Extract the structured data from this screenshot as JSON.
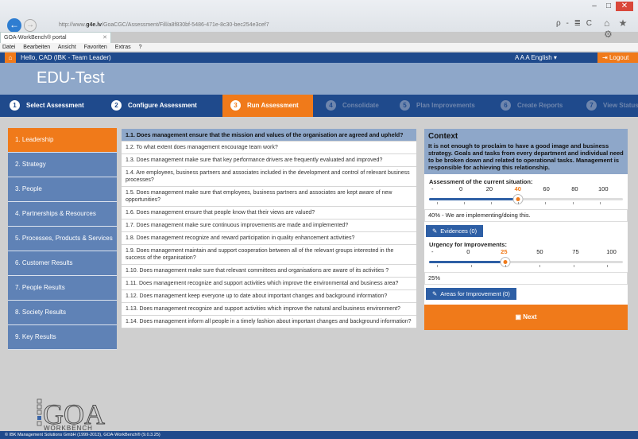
{
  "browser": {
    "url_prefix": "http://www.",
    "url_domain": "g4e.lv",
    "url_path": "/GoaCGC/Assessment/Fill/a8f830bf-5486-471e-8c30-bec254e3cef7",
    "tab_title": "GOA-WorkBench® portal",
    "menu": [
      "Datei",
      "Bearbeiten",
      "Ansicht",
      "Favoriten",
      "Extras",
      "?"
    ],
    "addr_tools": "ρ - ≣ C",
    "right_icons": "⌂ ★ ⚙"
  },
  "app": {
    "hello": "Hello, CAD (IBK - Team Leader)",
    "lang": "A A A   English ▾",
    "logout": "Logout",
    "title": "EDU-Test"
  },
  "steps": [
    {
      "num": "1",
      "label": "Select Assessment"
    },
    {
      "num": "2",
      "label": "Configure Assessment"
    },
    {
      "num": "3",
      "label": "Run Assessment"
    },
    {
      "num": "4",
      "label": "Consolidate"
    },
    {
      "num": "5",
      "label": "Plan Improvements"
    },
    {
      "num": "6",
      "label": "Create Reports"
    },
    {
      "num": "7",
      "label": "View Status"
    }
  ],
  "sidebar": [
    "1. Leadership",
    "2. Strategy",
    "3. People",
    "4. Partnerships & Resources",
    "5. Processes, Products & Services",
    "6. Customer Results",
    "7. People Results",
    "8. Society Results",
    "9. Key Results"
  ],
  "questions": [
    "1.1. Does management ensure that the mission and values of the organisation are agreed and upheld?",
    "1.2. To what extent does management encourage team work?",
    "1.3. Does management make sure that key performance drivers are frequently evaluated and improved?",
    "1.4. Are employees, business partners and associates included in the development and control of relevant business processes?",
    "1.5. Does management make sure that employees, business partners and associates are kept aware of new opportunities?",
    "1.6. Does management ensure that people know that their views are valued?",
    "1.7. Does management make sure continuous improvements are made and implemented?",
    "1.8. Does management recognize and reward participation in quality enhancement activities?",
    "1.9. Does management maintain and support cooperation between all of the relevant groups interested in the success of the organisation?",
    "1.10. Does management make sure that relevant committees and organisations are aware of its activities ?",
    "1.11. Does management recognize and support activities which improve the environmental and business area?",
    "1.12. Does management keep everyone up to date about important changes and background information?",
    "1.13. Does management recognize and support activities which improve the natural and business environment?",
    "1.14. Does management inform all people in a timely fashion about important changes and background information?"
  ],
  "context": {
    "title": "Context",
    "text": "It is not enough to proclaim to have a good image and business strategy. Goals and tasks from every department and individual need to be broken down and related to operational tasks. Management is responsible for achieving this relationship.",
    "assessment_label": "Assessment of the current situation:",
    "assessment_ticks": [
      "-",
      "0",
      "20",
      "40",
      "60",
      "80",
      "100"
    ],
    "assessment_value": 40,
    "assessment_text": "40% - We are implementing/doing this.",
    "evidences_label": "Evidences (0)",
    "urgency_label": "Urgency for Improvements:",
    "urgency_ticks": [
      "-",
      "0",
      "25",
      "50",
      "75",
      "100"
    ],
    "urgency_value": 25,
    "urgency_text": "25%",
    "areas_label": "Areas for Improvement (0)",
    "next_label": "Next"
  },
  "logo": {
    "letters": "GOA",
    "sub": "WORKBENCH"
  },
  "footer": "© IBK Management Solutions GmbH (1999-2013), GOA-WorkBench® (9.0.3.25)",
  "colors": {
    "accent": "#f07a1a",
    "navy": "#1f4a8c",
    "side": "#5f82b6"
  }
}
